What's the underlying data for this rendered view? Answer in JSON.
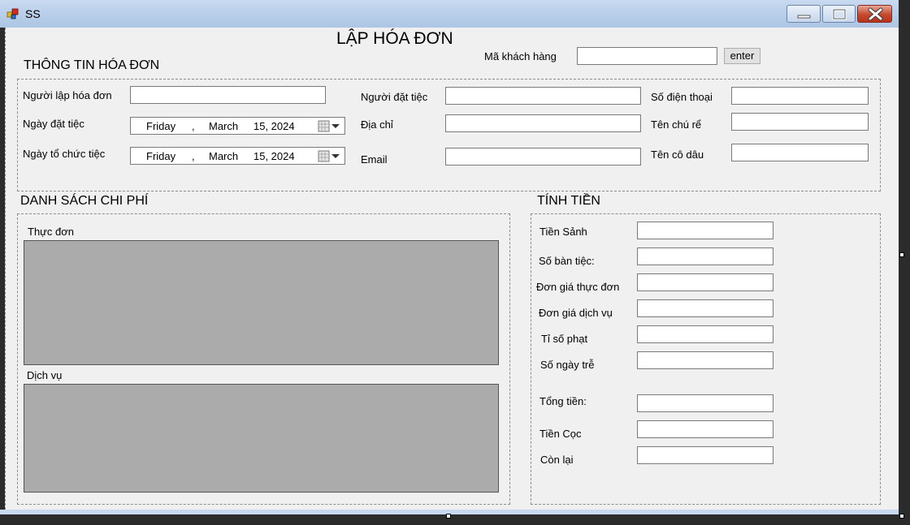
{
  "window": {
    "title": "SS"
  },
  "form": {
    "title": "LẬP HÓA ĐƠN",
    "customer_code_label": "Mã khách hàng",
    "customer_code_value": "",
    "enter_label": "enter"
  },
  "invoice_info": {
    "section_title": "THÔNG TIN HÓA ĐƠN",
    "creator_label": "Người lập hóa đơn",
    "booking_date_label": "Ngày đặt tiệc",
    "event_date_label": "Ngày tổ chức tiệc",
    "booker_label": "Người đặt tiệc",
    "address_label": "Địa chỉ",
    "email_label": "Email",
    "phone_label": "Số điện thoại",
    "groom_label": "Tên chú rể",
    "bride_label": "Tên cô dâu",
    "booking_date": {
      "weekday": "Friday",
      "sep": ",",
      "month": "March",
      "day_year": "15, 2024"
    },
    "event_date": {
      "weekday": "Friday",
      "sep": ",",
      "month": "March",
      "day_year": "15, 2024"
    }
  },
  "expenses": {
    "section_title": "DANH SÁCH CHI PHÍ",
    "menu_label": "Thực đơn",
    "services_label": "Dịch vụ"
  },
  "calc": {
    "section_title": "TÍNH TIỀN",
    "hall_fee_label": "Tiền Sảnh",
    "tables_label": "Số bàn tiệc:",
    "menu_price_label": "Đơn giá thực đơn",
    "service_price_label": "Đơn giá dịch vụ",
    "penalty_rate_label": "Tỉ số phạt",
    "late_days_label": "Số ngày trễ",
    "total_label": "Tổng tiền:",
    "deposit_label": "Tiền Cọc",
    "remaining_label": "Còn lại"
  },
  "colors": {
    "titlebar": "#b6cde9",
    "form_bg": "#f0f0f0",
    "grid_bg": "#ababab",
    "close_red": "#c44a2e"
  }
}
